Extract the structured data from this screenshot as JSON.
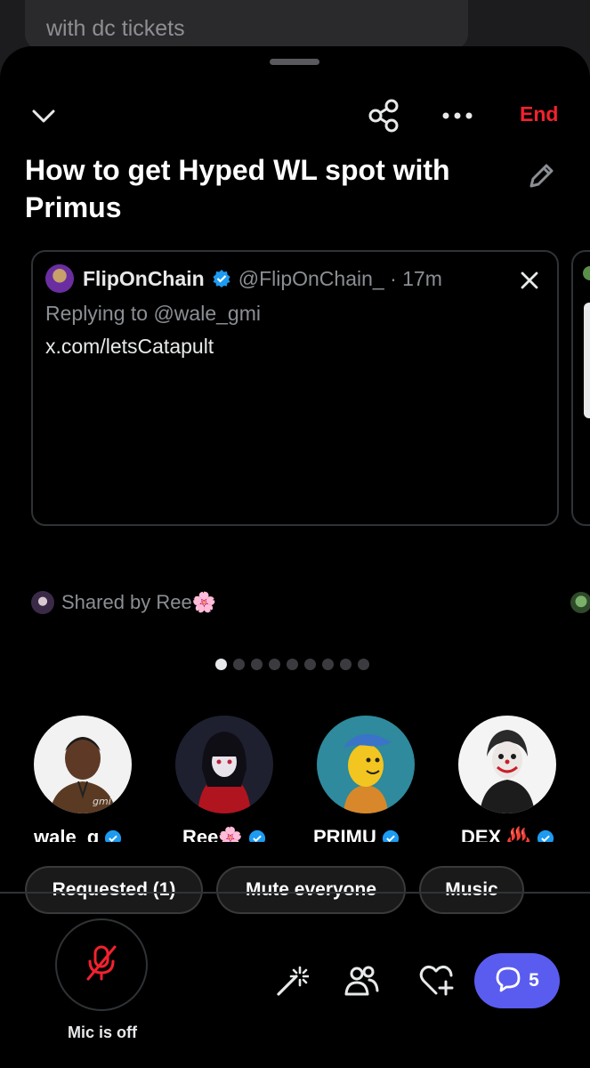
{
  "background_comment": {
    "text": "with dc tickets"
  },
  "header": {
    "collapse_icon": "chevron-down-icon",
    "share_icon": "share-icon",
    "more_icon": "more-horizontal-icon",
    "end_label": "End",
    "end_color": "#f4212e"
  },
  "space": {
    "title": "How to get Hyped WL spot with Primus",
    "edit_icon": "pencil-icon"
  },
  "pinned_post": {
    "author": "FlipOnChain",
    "handle_time": "@FlipOnChain_ · 17m",
    "replying_to": "Replying to @wale_gmi",
    "body": "x.com/letsCatapult",
    "close_icon": "close-icon",
    "verified_color": "#1d9bf0"
  },
  "shared_by": "Shared by Ree🌸",
  "carousel": {
    "total_dots": 9,
    "active_index": 0
  },
  "speakers": [
    {
      "name": "wale_g",
      "verified": true
    },
    {
      "name": "Ree🌸",
      "verified": true
    },
    {
      "name": "PRIMU",
      "verified": true
    },
    {
      "name": "DEX ♨️",
      "verified": true
    }
  ],
  "actions": {
    "requested": "Requested (1)",
    "mute_everyone": "Mute everyone",
    "music": "Music"
  },
  "bottom_bar": {
    "mic_label": "Mic is off",
    "mic_icon": "mic-off-icon",
    "effects_icon": "magic-wand-icon",
    "people_icon": "people-icon",
    "react_icon": "heart-plus-icon",
    "chat_icon": "chat-bubble-icon",
    "chat_count": "5",
    "chat_color": "#5a5cf0",
    "mic_color": "#f4212e"
  }
}
